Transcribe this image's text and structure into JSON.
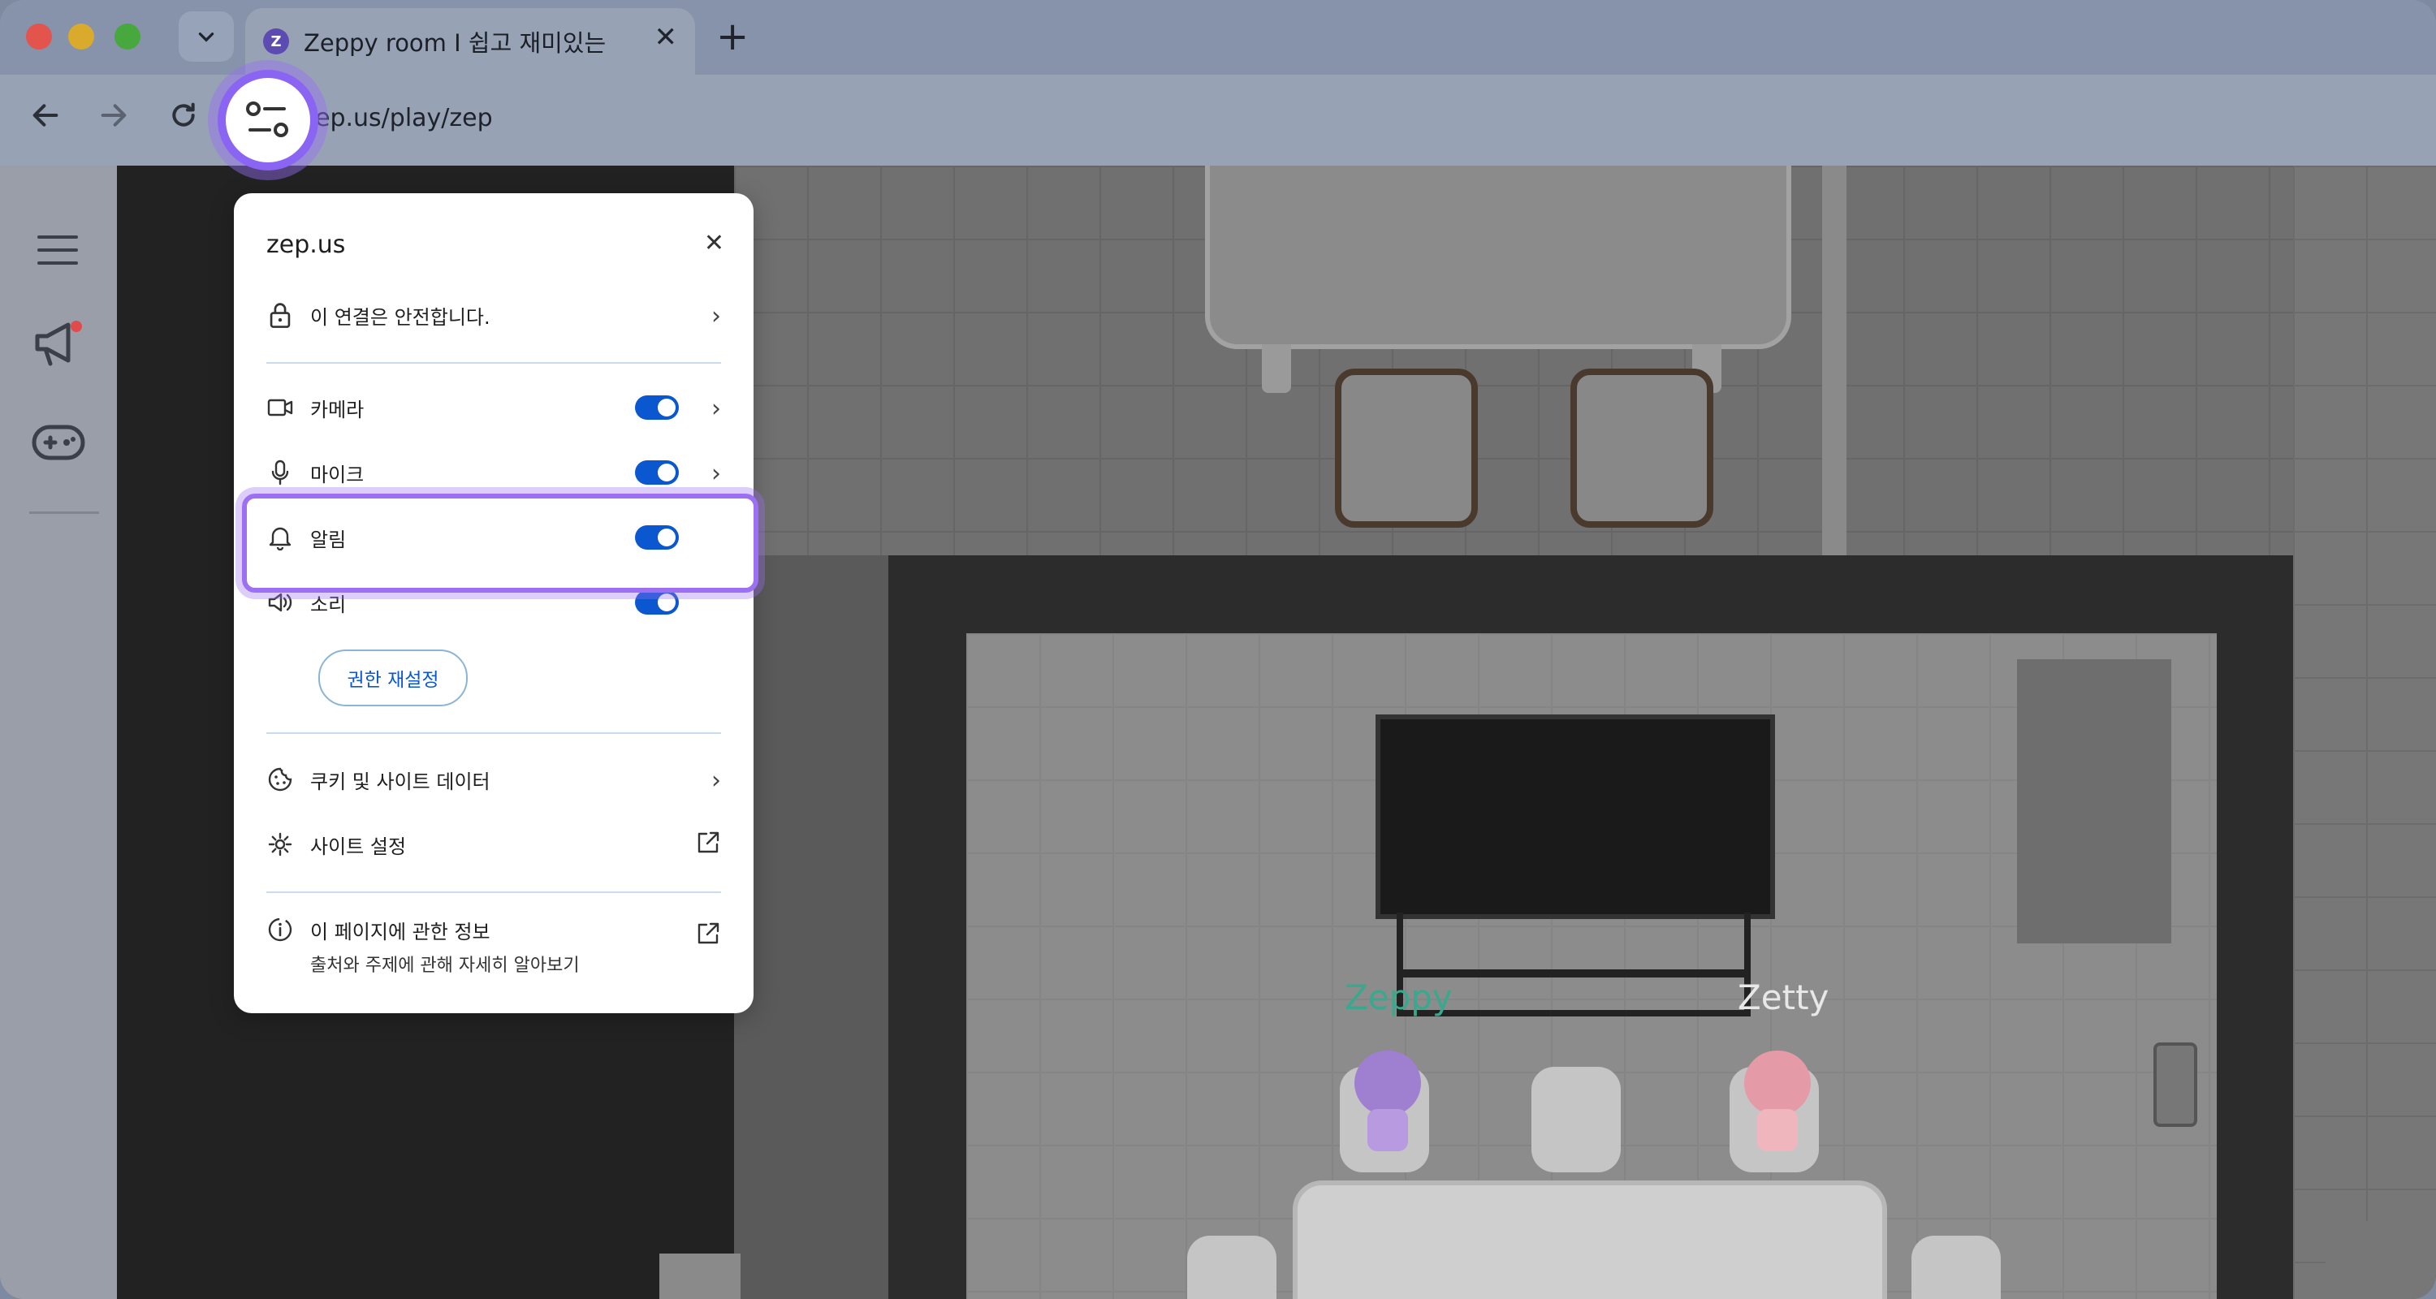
{
  "browser": {
    "tab": {
      "title": "Zeppy room I 쉽고 재미있는",
      "favicon_letter": "Z"
    },
    "new_tab_label": "+",
    "url": "zep.us/play/zep",
    "url_visible": "ep.us/play/zep"
  },
  "sidebar": {
    "items": [
      "menu-icon",
      "megaphone-icon",
      "gamepad-icon"
    ],
    "notification_dot_color": "#e24b4b"
  },
  "game": {
    "avatars": [
      {
        "name": "Zeppy",
        "color": "#3aa88c"
      },
      {
        "name": "Zetty",
        "color": "#e8e8e8"
      }
    ]
  },
  "site_info_popup": {
    "domain": "zep.us",
    "connection": "이 연결은 안전합니다.",
    "permissions": [
      {
        "label": "카메라",
        "enabled": true,
        "has_arrow": true
      },
      {
        "label": "마이크",
        "enabled": true,
        "has_arrow": true
      },
      {
        "label": "알림",
        "enabled": true,
        "has_arrow": false
      },
      {
        "label": "소리",
        "enabled": true,
        "has_arrow": false
      }
    ],
    "reset_button": "권한 재설정",
    "cookies": "쿠키 및 사이트 데이터",
    "site_settings": "사이트 설정",
    "page_info_title": "이 페이지에 관한 정보",
    "page_info_sub": "출처와 주제에 관해 자세히 알아보기"
  },
  "colors": {
    "toggle_on": "#0b57d0",
    "highlight": "#9d6ff2"
  }
}
